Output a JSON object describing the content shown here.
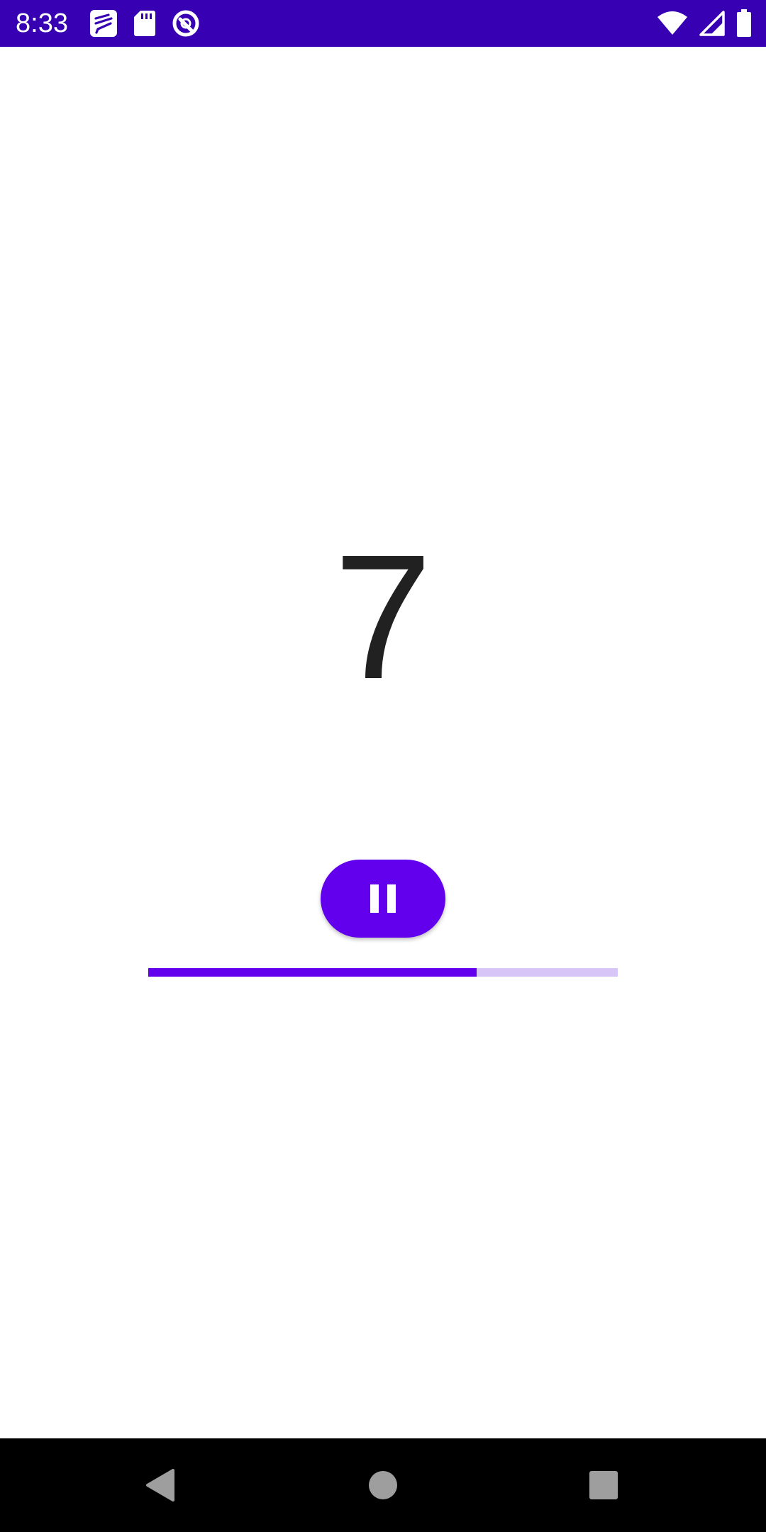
{
  "status_bar": {
    "time": "8:33",
    "background": "#3700b3",
    "left_icons": [
      "brush-notification-icon",
      "sd-card-icon",
      "data-saver-icon"
    ],
    "right_icons": [
      "wifi-icon",
      "cellular-signal-icon",
      "battery-icon"
    ]
  },
  "main": {
    "counter_value": "7",
    "pause_button": {
      "icon": "pause-icon",
      "color": "#6200ee"
    },
    "progress": {
      "value": 0.7,
      "fill_color": "#6200ee",
      "track_color": "#d7c5f7"
    }
  },
  "nav_bar": {
    "buttons": [
      "back-icon",
      "home-icon",
      "recents-icon"
    ]
  }
}
